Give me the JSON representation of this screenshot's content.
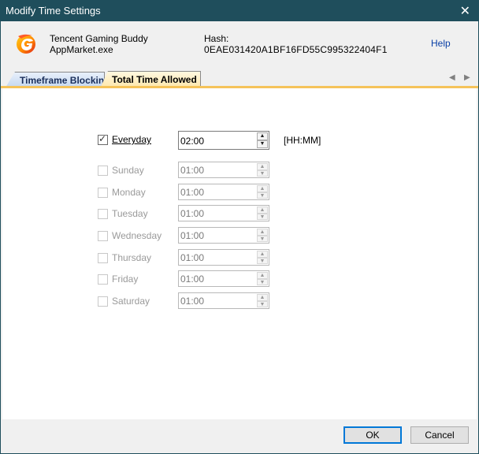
{
  "window": {
    "title": "Modify Time Settings"
  },
  "app": {
    "name": "Tencent Gaming Buddy",
    "exe": "AppMarket.exe",
    "hash_label": "Hash:",
    "hash_value": "0EAE031420A1BF16FD55C995322404F1",
    "help_label": "Help"
  },
  "tabs": [
    {
      "label": "Timeframe Blocking",
      "active": false
    },
    {
      "label": "Total Time Allowed",
      "active": true
    }
  ],
  "everyday": {
    "label": "Everyday",
    "checked": true,
    "value": "02:00",
    "format": "[HH:MM]"
  },
  "days": [
    {
      "label": "Sunday",
      "checked": false,
      "value": "01:00"
    },
    {
      "label": "Monday",
      "checked": false,
      "value": "01:00"
    },
    {
      "label": "Tuesday",
      "checked": false,
      "value": "01:00"
    },
    {
      "label": "Wednesday",
      "checked": false,
      "value": "01:00"
    },
    {
      "label": "Thursday",
      "checked": false,
      "value": "01:00"
    },
    {
      "label": "Friday",
      "checked": false,
      "value": "01:00"
    },
    {
      "label": "Saturday",
      "checked": false,
      "value": "01:00"
    }
  ],
  "buttons": {
    "ok": "OK",
    "cancel": "Cancel"
  },
  "colors": {
    "titlebar": "#1f4e5c",
    "active_tab": "#fde6a8",
    "accent_line": "#f5c35a",
    "ok_border": "#0078d7"
  }
}
